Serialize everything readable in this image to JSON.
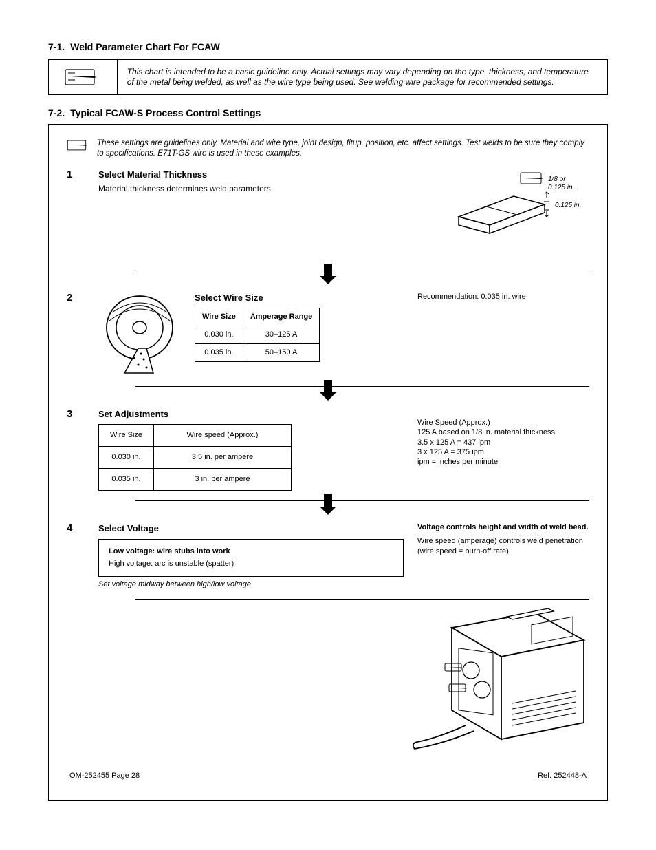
{
  "sect1": {
    "num": "7-1.",
    "title": "Weld Parameter Chart For FCAW",
    "note": "This chart is intended to be a basic guideline only. Actual settings may vary depending on the type, thickness, and temperature of the metal being welded, as well as the wire type being used. See welding wire package for recommended settings."
  },
  "sect2": {
    "num": "7-2.",
    "title": "Typical FCAW-S Process Control Settings"
  },
  "intro_note": "These settings are guidelines only. Material and wire type, joint design, fitup, position, etc. affect settings. Test welds to be sure they comply to specifications. E71T-GS wire is used in these examples.",
  "step1": {
    "num": "1",
    "heading": "Select Material Thickness",
    "body": "Material thickness determines weld parameters.",
    "callout_a": "1/8 or 0.125 in.",
    "callout_b": "0.125 in."
  },
  "step2": {
    "num": "2",
    "heading": "Select Wire Size",
    "table": {
      "hdr1": "Wire Size",
      "hdr2": "Amperage Range",
      "r1c1": "0.030 in.",
      "r1c2": "30–125 A",
      "r2c1": "0.035 in.",
      "r2c2": "50–150 A"
    },
    "note": "Recommendation: 0.035 in. wire"
  },
  "step3": {
    "num": "3",
    "heading": "Set Adjustments",
    "table": {
      "hdr1": "Wire Size",
      "hdr2": "Wire speed (Approx.)",
      "hdr3": "3.5 in. per ampere",
      "hdr4": "3 in. per ampere",
      "r1c1": "0.030 in.",
      "r2c1": "0.035 in."
    },
    "sidebar": "Wire Speed (Approx.)\n125 A based on 1/8 in. material thickness\n3.5 x 125 A = 437 ipm\n3 x 125 A = 375 ipm\nipm = inches per minute"
  },
  "step4": {
    "num": "4",
    "heading": "Select Voltage",
    "box_title": "Low voltage: wire stubs into work",
    "box_body": "High voltage: arc is unstable (spatter)",
    "sub": "Set voltage midway between high/low voltage",
    "sidebar_title": "Voltage controls height and width of weld bead.",
    "sidebar_body": "Wire speed (amperage) controls weld penetration (wire speed = burn-off rate)"
  },
  "footer": {
    "left": "OM-252455 Page 28",
    "right": "Ref. 252448-A"
  }
}
